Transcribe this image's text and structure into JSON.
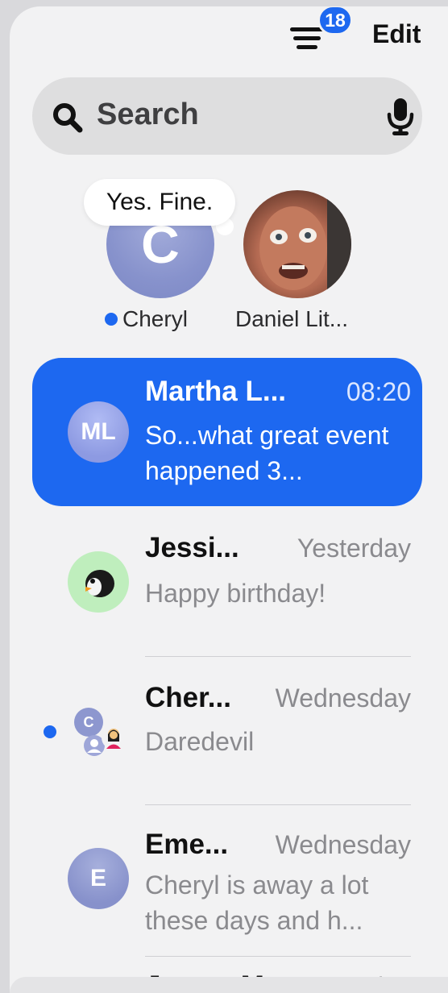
{
  "topbar": {
    "badge_count": "18",
    "edit_label": "Edit",
    "filter_icon": "filter-lines-icon"
  },
  "search": {
    "placeholder": "Search",
    "icon": "search-icon",
    "mic_icon": "microphone-icon"
  },
  "pinned": [
    {
      "initial": "C",
      "name": "Cheryl",
      "bubble": "Yes. Fine.",
      "unread": true
    },
    {
      "name": "Daniel Lit..."
    }
  ],
  "conversations": [
    {
      "initials": "ML",
      "name": "Martha L...",
      "time": "08:20",
      "message": "So...what great event happened 3...",
      "selected": true
    },
    {
      "name": "Jessi...",
      "time": "Yesterday",
      "message": "Happy birthday!",
      "icon": "penguin-icon"
    },
    {
      "initial": "C",
      "name": "Cher...",
      "time": "Wednesday",
      "message": "Daredevil",
      "unread": true,
      "icon": "group-avatar-icon"
    },
    {
      "initial": "E",
      "name": "Eme...",
      "time": "Wednesday",
      "message": "Cheryl is away a lot these days and h..."
    },
    {
      "name": "James M",
      "time": "Tuesday"
    }
  ],
  "colors": {
    "accent": "#1d68f0",
    "background": "#f2f2f3",
    "secondary_text": "#8a8a8e"
  }
}
